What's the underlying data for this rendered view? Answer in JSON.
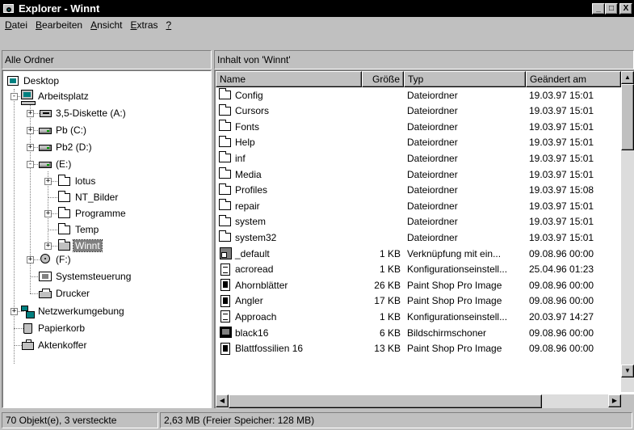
{
  "window": {
    "title": "Explorer - Winnt",
    "controls": {
      "minimize": "_",
      "maximize": "□",
      "close": "X"
    }
  },
  "menu": {
    "items": [
      {
        "ul": "D",
        "rest": "atei"
      },
      {
        "ul": "B",
        "rest": "earbeiten"
      },
      {
        "ul": "A",
        "rest": "nsicht"
      },
      {
        "ul": "E",
        "rest": "xtras"
      },
      {
        "ul": "?",
        "rest": ""
      }
    ]
  },
  "left_header": "Alle Ordner",
  "right_header": "Inhalt von 'Winnt'",
  "tree": [
    {
      "label": "Desktop",
      "icon": "desktop-icon"
    },
    {
      "label": "Arbeitsplatz",
      "icon": "computer-icon",
      "pm": "-"
    },
    {
      "label": "3,5-Diskette (A:)",
      "icon": "floppy-drive-icon",
      "pm": "+"
    },
    {
      "label": "Pb (C:)",
      "icon": "hard-drive-icon",
      "pm": "+"
    },
    {
      "label": "Pb2 (D:)",
      "icon": "hard-drive-icon",
      "pm": "+"
    },
    {
      "label": "(E:)",
      "icon": "hard-drive-icon",
      "pm": "-"
    },
    {
      "label": "lotus",
      "icon": "folder-icon",
      "pm": "+"
    },
    {
      "label": "NT_Bilder",
      "icon": "folder-icon"
    },
    {
      "label": "Programme",
      "icon": "folder-icon",
      "pm": "+"
    },
    {
      "label": "Temp",
      "icon": "folder-icon"
    },
    {
      "label": "Winnt",
      "icon": "open-folder-icon",
      "pm": "+",
      "selected": true
    },
    {
      "label": "(F:)",
      "icon": "cdrom-drive-icon",
      "pm": "+"
    },
    {
      "label": "Systemsteuerung",
      "icon": "control-panel-icon"
    },
    {
      "label": "Drucker",
      "icon": "printer-icon"
    },
    {
      "label": "Netzwerkumgebung",
      "icon": "network-icon",
      "pm": "+"
    },
    {
      "label": "Papierkorb",
      "icon": "recycle-bin-icon"
    },
    {
      "label": "Aktenkoffer",
      "icon": "briefcase-icon"
    }
  ],
  "columns": [
    "Name",
    "Größe",
    "Typ",
    "Geändert am"
  ],
  "files": [
    {
      "name": "Config",
      "size": "",
      "type": "Dateiordner",
      "modified": "19.03.97 15:01",
      "icon": "folder-icon"
    },
    {
      "name": "Cursors",
      "size": "",
      "type": "Dateiordner",
      "modified": "19.03.97 15:01",
      "icon": "folder-icon"
    },
    {
      "name": "Fonts",
      "size": "",
      "type": "Dateiordner",
      "modified": "19.03.97 15:01",
      "icon": "folder-icon"
    },
    {
      "name": "Help",
      "size": "",
      "type": "Dateiordner",
      "modified": "19.03.97 15:01",
      "icon": "folder-icon"
    },
    {
      "name": "inf",
      "size": "",
      "type": "Dateiordner",
      "modified": "19.03.97 15:01",
      "icon": "folder-icon"
    },
    {
      "name": "Media",
      "size": "",
      "type": "Dateiordner",
      "modified": "19.03.97 15:01",
      "icon": "folder-icon"
    },
    {
      "name": "Profiles",
      "size": "",
      "type": "Dateiordner",
      "modified": "19.03.97 15:08",
      "icon": "folder-icon"
    },
    {
      "name": "repair",
      "size": "",
      "type": "Dateiordner",
      "modified": "19.03.97 15:01",
      "icon": "folder-icon"
    },
    {
      "name": "system",
      "size": "",
      "type": "Dateiordner",
      "modified": "19.03.97 15:01",
      "icon": "folder-icon"
    },
    {
      "name": "system32",
      "size": "",
      "type": "Dateiordner",
      "modified": "19.03.97 15:01",
      "icon": "folder-icon"
    },
    {
      "name": "_default",
      "size": "1 KB",
      "type": "Verknüpfung mit ein...",
      "modified": "09.08.96 00:00",
      "icon": "shortcut-icon"
    },
    {
      "name": "acroread",
      "size": "1 KB",
      "type": "Konfigurationseinstell...",
      "modified": "25.04.96 01:23",
      "icon": "config-file-icon"
    },
    {
      "name": "Ahornblätter",
      "size": "26 KB",
      "type": "Paint Shop Pro Image",
      "modified": "09.08.96 00:00",
      "icon": "image-file-icon"
    },
    {
      "name": "Angler",
      "size": "17 KB",
      "type": "Paint Shop Pro Image",
      "modified": "09.08.96 00:00",
      "icon": "image-file-icon"
    },
    {
      "name": "Approach",
      "size": "1 KB",
      "type": "Konfigurationseinstell...",
      "modified": "20.03.97 14:27",
      "icon": "config-file-icon"
    },
    {
      "name": "black16",
      "size": "6 KB",
      "type": "Bildschirmschoner",
      "modified": "09.08.96 00:00",
      "icon": "screensaver-icon"
    },
    {
      "name": "Blattfossilien 16",
      "size": "13 KB",
      "type": "Paint Shop Pro Image",
      "modified": "09.08.96 00:00",
      "icon": "image-file-icon"
    }
  ],
  "status": {
    "objects": "70 Objekt(e), 3 versteckte",
    "size": "2,63 MB (Freier Speicher: 128 MB)"
  }
}
